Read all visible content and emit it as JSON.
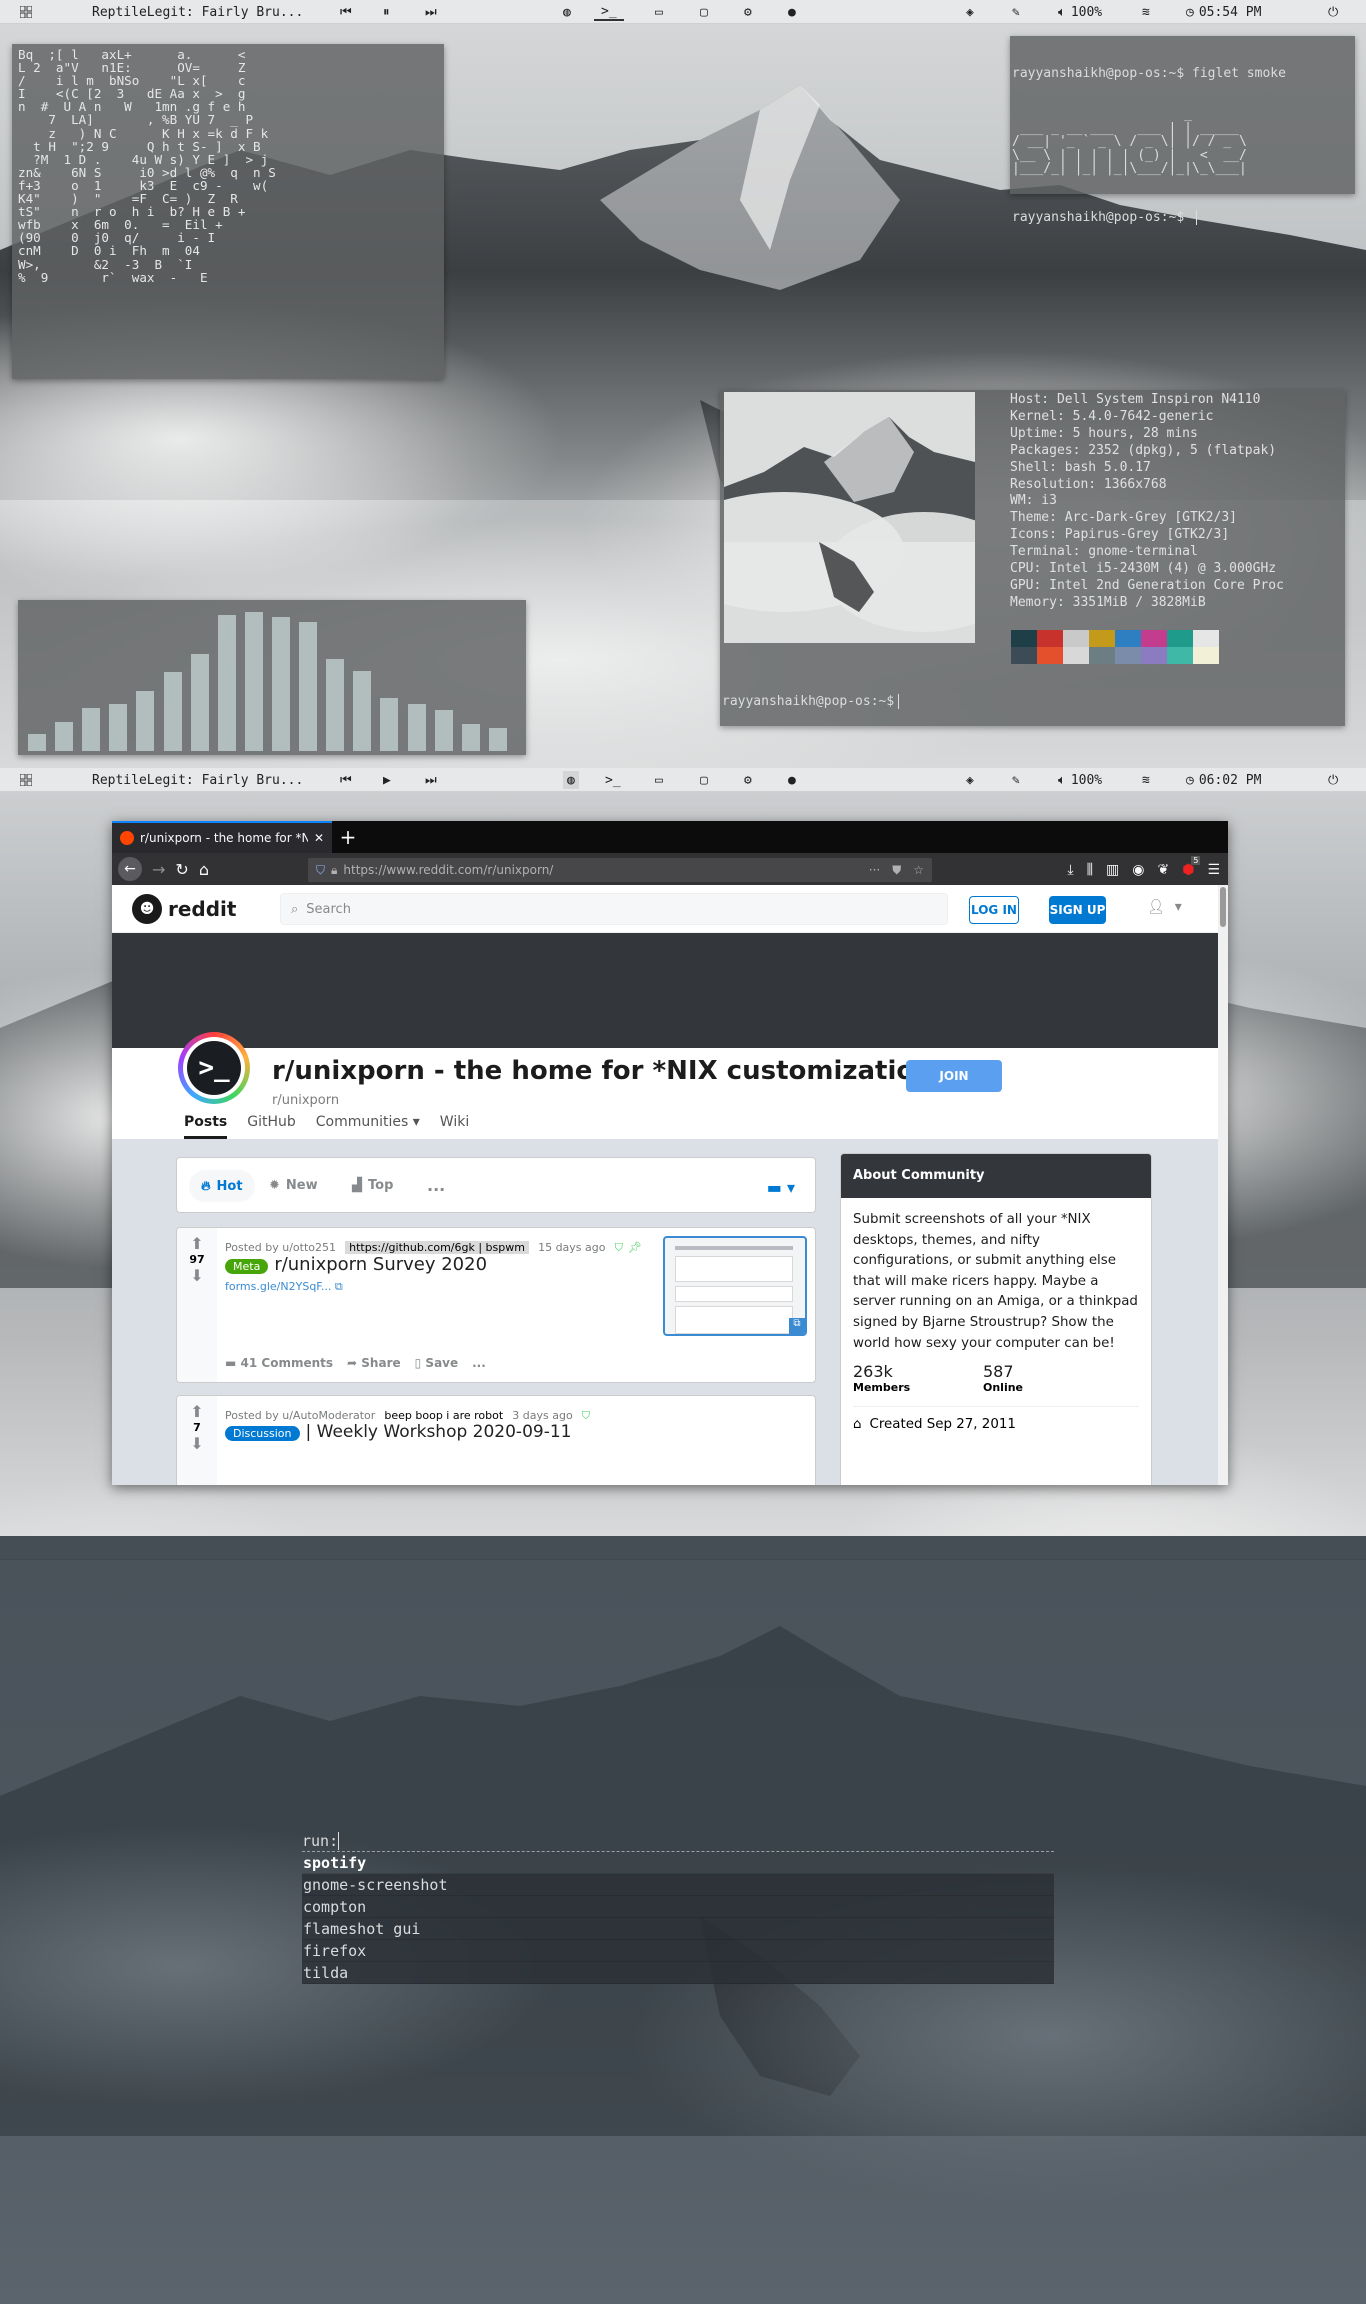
{
  "screen1": {
    "statusbar": {
      "media_title": "ReptileLegit: Fairly Bru...",
      "volume": "100%",
      "clock": "05:54 PM"
    },
    "matrix_rain": [
      "Bq  ;[ l   axL+      a.      <",
      "L 2  a\"V   n1E:      OV=     Z",
      "/    i l m  bNSo    \"L x[    c",
      "I    <(C [2  3   dE Aa x  >  g",
      "n  #  U A n   W   1mn .g f e h",
      "    7  LA]       , %B YU 7  _ P",
      "    z   ) N C      K H x =k d F k",
      "  t H  \";2 9     Q h t S- ]  x B",
      "  ?M  1 D .    4u W s) Y E ]  > j",
      "zn&    6N S     i0 >d l @%  q  n S",
      "f+3    o  1     k3  E  c9 -    w(",
      "K4\"    )  \"    =F  C= )  Z  R",
      "tS\"    n  r o  h i  b? H e B +",
      "wfb    x  6m  0.   =  Eil +",
      "(90    0  j0  q/     i - I",
      "cnM    D  0 i  Fh  m  04",
      "W>,       &2  -3  B  `I",
      "%  9       r`  wax  -   E"
    ],
    "terminal1": {
      "prompt": "rayyanshaikh@pop-os:~$ figlet smoke",
      "figlet": [
        "                      _",
        " ___ _ __ ___   ___ | | _____",
        "/ __| '_ ` _ \\ / _ \\| |/ / _ \\",
        "\\__ \\ | | | | | (_) |   <  __/",
        "|___/_| |_| |_|\\___/|_|\\_\\___|"
      ],
      "prompt2": "rayyanshaikh@pop-os:~$ "
    },
    "visualizer_levels": [
      0.12,
      0.2,
      0.3,
      0.33,
      0.42,
      0.55,
      0.68,
      0.95,
      0.97,
      0.94,
      0.9,
      0.64,
      0.56,
      0.37,
      0.33,
      0.29,
      0.19,
      0.16
    ],
    "neofetch": {
      "lines": [
        "Host: Dell System Inspiron N4110",
        "Kernel: 5.4.0-7642-generic",
        "Uptime: 5 hours, 28 mins",
        "Packages: 2352 (dpkg), 5 (flatpak)",
        "Shell: bash 5.0.17",
        "Resolution: 1366x768",
        "WM: i3",
        "Theme: Arc-Dark-Grey [GTK2/3]",
        "Icons: Papirus-Grey [GTK2/3]",
        "Terminal: gnome-terminal",
        "CPU: Intel i5-2430M (4) @ 3.000GHz",
        "GPU: Intel 2nd Generation Core Proc",
        "Memory: 3351MiB / 3828MiB"
      ],
      "palette_top": [
        "#1e3e48",
        "#c8322d",
        "#c9c9c9",
        "#c49a1a",
        "#2e7fc2",
        "#c43c8d",
        "#1f9b8c",
        "#e6e6e6"
      ],
      "palette_bottom": [
        "#3c4b55",
        "#e4502c",
        "#d8d8d8",
        "#6d7d84",
        "#7a8caa",
        "#8b7cc2",
        "#40b8a8",
        "#f3f0d8"
      ],
      "prompt": "rayyanshaikh@pop-os:~$ "
    }
  },
  "screen2": {
    "statusbar": {
      "media_title": "ReptileLegit: Fairly Bru...",
      "volume": "100%",
      "clock": "06:02 PM"
    },
    "browser": {
      "tab_title": "r/unixporn - the home for *NIX",
      "url": "https://www.reddit.com/r/unixporn/",
      "badge_count": "5",
      "reddit": {
        "logo_text": "reddit",
        "search_placeholder": "Search",
        "login": "LOG IN",
        "signup": "SIGN UP",
        "sub_title": "r/unixporn - the home for *NIX customization!",
        "sub_name": "r/unixporn",
        "join": "JOIN",
        "nav_tabs": [
          "Posts",
          "GitHub",
          "Communities",
          "Wiki"
        ],
        "sort": {
          "hot": "Hot",
          "new": "New",
          "top": "Top",
          "more": "..."
        },
        "posts": [
          {
            "votes": "97",
            "posted_by": "Posted by u/otto251",
            "user_flair": "https://github.com/6gk  | bspwm",
            "age": "15 days ago",
            "flair": "Meta",
            "flair_color": "#46a508",
            "title": "r/unixporn Survey 2020",
            "link": "forms.gle/N2YSqF...",
            "comments": "41 Comments",
            "share": "Share",
            "save": "Save",
            "more": "..."
          },
          {
            "votes": "7",
            "posted_by": "Posted by u/AutoModerator",
            "user_flair": "beep boop i are robot",
            "age": "3 days ago",
            "flair": "Discussion",
            "flair_color": "#0079d3",
            "title": "| Weekly Workshop 2020-09-11"
          }
        ],
        "about": {
          "header": "About Community",
          "description": "Submit screenshots of all your *NIX desktops, themes, and nifty configurations, or submit anything else that will make ricers happy. Maybe a server running on an Amiga, or a thinkpad signed by Bjarne Stroustrup? Show the world how sexy your computer can be!",
          "members_count": "263k",
          "members_label": "Members",
          "online_count": "587",
          "online_label": "Online",
          "created": "Created Sep 27, 2011"
        }
      }
    }
  },
  "screen3": {
    "launcher": {
      "prompt": "run:",
      "items": [
        "spotify",
        "gnome-screenshot",
        "compton",
        "flameshot gui",
        "firefox",
        "tilda"
      ]
    }
  }
}
